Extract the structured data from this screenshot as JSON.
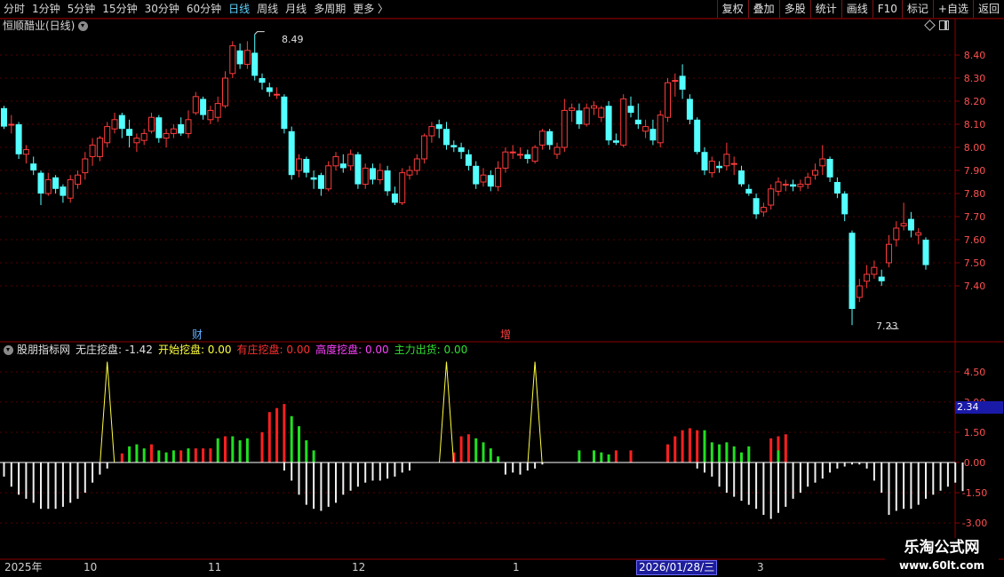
{
  "topbar": {
    "periods": [
      "分时",
      "1分钟",
      "5分钟",
      "15分钟",
      "30分钟",
      "60分钟",
      "日线",
      "周线",
      "月线",
      "多周期",
      "更多 〉"
    ],
    "active_period": "日线",
    "buttons": [
      "复权",
      "叠加",
      "多股",
      "统计",
      "画线",
      "F10",
      "标记",
      "+自选",
      "返回"
    ]
  },
  "stock": {
    "title": "恒顺醋业(日线)"
  },
  "price_axis": {
    "ticks": [
      "8.40",
      "8.30",
      "8.20",
      "8.10",
      "8.00",
      "7.90",
      "7.80",
      "7.70",
      "7.60",
      "7.50",
      "7.40"
    ]
  },
  "annotations": {
    "high": "8.49",
    "low": "7.23",
    "marker_cai": "财",
    "marker_zeng": "增"
  },
  "indicator": {
    "name": "股朋指标网",
    "items": [
      {
        "label": "无庄挖盘:",
        "value": "-1.42",
        "color": "#e0e0e0"
      },
      {
        "label": "开始挖盘:",
        "value": "0.00",
        "color": "#ffff40"
      },
      {
        "label": "有庄挖盘:",
        "value": "0.00",
        "color": "#ff3030"
      },
      {
        "label": "高度挖盘:",
        "value": "0.00",
        "color": "#ff40ff"
      },
      {
        "label": "主力出货:",
        "value": "0.00",
        "color": "#30e030"
      }
    ],
    "axis_ticks": [
      "4.50",
      "3.00",
      "1.50",
      "0.00",
      "-1.50",
      "-3.00"
    ],
    "current_value": "2.34"
  },
  "date_axis": {
    "labels": [
      "2025年",
      "10",
      "11",
      "12",
      "1",
      "3"
    ],
    "selected": "2026/01/28/三"
  },
  "watermark": {
    "line1": "乐淘公式网",
    "line2": "www.60lt.com"
  },
  "colors": {
    "up": "#ff3b3b",
    "down": "#54ffff",
    "grid": "#5a0000",
    "border": "#8b0000"
  },
  "chart_data": {
    "type": "candlestick",
    "title": "恒顺醋业(日线)",
    "ylim": [
      7.18,
      8.58
    ],
    "high_label": 8.49,
    "low_label": 7.23,
    "candles": [
      [
        8.17,
        8.09,
        8.18,
        8.08
      ],
      [
        8.1,
        8.1,
        8.14,
        8.06
      ],
      [
        8.1,
        7.97,
        8.11,
        7.95
      ],
      [
        7.97,
        7.99,
        8.01,
        7.93
      ],
      [
        7.93,
        7.9,
        7.96,
        7.88
      ],
      [
        7.89,
        7.8,
        7.9,
        7.75
      ],
      [
        7.8,
        7.86,
        7.89,
        7.79
      ],
      [
        7.87,
        7.82,
        7.88,
        7.8
      ],
      [
        7.83,
        7.79,
        7.84,
        7.76
      ],
      [
        7.78,
        7.86,
        7.88,
        7.76
      ],
      [
        7.84,
        7.88,
        7.9,
        7.82
      ],
      [
        7.89,
        7.95,
        7.98,
        7.86
      ],
      [
        7.96,
        8.01,
        8.04,
        7.92
      ],
      [
        7.96,
        8.04,
        8.05,
        7.94
      ],
      [
        8.02,
        8.09,
        8.11,
        8.0
      ],
      [
        8.08,
        8.12,
        8.15,
        8.06
      ],
      [
        8.14,
        8.08,
        8.15,
        8.04
      ],
      [
        8.08,
        8.05,
        8.12,
        8.0
      ],
      [
        8.02,
        8.04,
        8.06,
        7.98
      ],
      [
        8.03,
        8.06,
        8.08,
        8.01
      ],
      [
        8.07,
        8.13,
        8.15,
        8.06
      ],
      [
        8.13,
        8.04,
        8.14,
        8.02
      ],
      [
        8.04,
        8.06,
        8.08,
        8.0
      ],
      [
        8.06,
        8.08,
        8.1,
        8.04
      ],
      [
        8.1,
        8.06,
        8.13,
        8.05
      ],
      [
        8.06,
        8.12,
        8.16,
        8.04
      ],
      [
        8.15,
        8.22,
        8.24,
        8.14
      ],
      [
        8.21,
        8.14,
        8.22,
        8.12
      ],
      [
        8.12,
        8.16,
        8.18,
        8.1
      ],
      [
        8.13,
        8.19,
        8.22,
        8.11
      ],
      [
        8.18,
        8.3,
        8.33,
        8.17
      ],
      [
        8.32,
        8.44,
        8.46,
        8.3
      ],
      [
        8.42,
        8.36,
        8.45,
        8.34
      ],
      [
        8.36,
        8.42,
        8.46,
        8.34
      ],
      [
        8.41,
        8.31,
        8.49,
        8.29
      ],
      [
        8.3,
        8.28,
        8.32,
        8.25
      ],
      [
        8.26,
        8.24,
        8.28,
        8.22
      ],
      [
        8.23,
        8.23,
        8.26,
        8.21
      ],
      [
        8.22,
        8.08,
        8.23,
        8.06
      ],
      [
        8.07,
        7.88,
        8.09,
        7.86
      ],
      [
        7.9,
        7.95,
        7.97,
        7.87
      ],
      [
        7.95,
        7.89,
        7.96,
        7.87
      ],
      [
        7.87,
        7.86,
        7.9,
        7.82
      ],
      [
        7.88,
        7.82,
        7.89,
        7.79
      ],
      [
        7.82,
        7.92,
        7.94,
        7.81
      ],
      [
        7.92,
        7.96,
        7.98,
        7.9
      ],
      [
        7.93,
        7.91,
        7.97,
        7.89
      ],
      [
        7.92,
        7.97,
        7.99,
        7.9
      ],
      [
        7.97,
        7.84,
        7.98,
        7.82
      ],
      [
        7.84,
        7.91,
        7.93,
        7.82
      ],
      [
        7.91,
        7.86,
        7.93,
        7.84
      ],
      [
        7.86,
        7.9,
        7.93,
        7.84
      ],
      [
        7.9,
        7.81,
        7.92,
        7.79
      ],
      [
        7.8,
        7.76,
        7.83,
        7.75
      ],
      [
        7.76,
        7.89,
        7.91,
        7.75
      ],
      [
        7.88,
        7.9,
        7.92,
        7.86
      ],
      [
        7.9,
        7.95,
        7.97,
        7.88
      ],
      [
        7.95,
        8.05,
        8.06,
        7.93
      ],
      [
        8.05,
        8.09,
        8.11,
        8.02
      ],
      [
        8.1,
        8.08,
        8.12,
        8.04
      ],
      [
        8.08,
        8.01,
        8.11,
        7.99
      ],
      [
        8.01,
        8.0,
        8.03,
        7.98
      ],
      [
        8.0,
        7.98,
        8.02,
        7.95
      ],
      [
        7.97,
        7.92,
        7.99,
        7.9
      ],
      [
        7.92,
        7.84,
        7.94,
        7.82
      ],
      [
        7.85,
        7.88,
        7.91,
        7.83
      ],
      [
        7.88,
        7.83,
        7.9,
        7.81
      ],
      [
        7.83,
        7.91,
        7.94,
        7.81
      ],
      [
        7.91,
        7.98,
        8.0,
        7.89
      ],
      [
        7.98,
        7.98,
        8.01,
        7.95
      ],
      [
        7.97,
        7.97,
        8.0,
        7.95
      ],
      [
        7.97,
        7.95,
        7.99,
        7.93
      ],
      [
        7.94,
        8.0,
        8.01,
        7.93
      ],
      [
        8.01,
        8.07,
        8.08,
        7.99
      ],
      [
        8.07,
        8.01,
        8.08,
        7.99
      ],
      [
        7.97,
        8.0,
        8.02,
        7.95
      ],
      [
        8.0,
        8.16,
        8.21,
        7.98
      ],
      [
        8.16,
        8.17,
        8.19,
        8.11
      ],
      [
        8.16,
        8.1,
        8.19,
        8.08
      ],
      [
        8.1,
        8.17,
        8.19,
        8.09
      ],
      [
        8.17,
        8.18,
        8.2,
        8.14
      ],
      [
        8.13,
        8.17,
        8.18,
        8.11
      ],
      [
        8.18,
        8.03,
        8.2,
        8.01
      ],
      [
        8.03,
        8.02,
        8.06,
        8.01
      ],
      [
        8.01,
        8.21,
        8.23,
        8.0
      ],
      [
        8.18,
        8.15,
        8.22,
        8.13
      ],
      [
        8.12,
        8.1,
        8.19,
        8.08
      ],
      [
        8.07,
        8.09,
        8.12,
        8.04
      ],
      [
        8.08,
        8.03,
        8.12,
        8.01
      ],
      [
        8.02,
        8.14,
        8.16,
        8.0
      ],
      [
        8.13,
        8.28,
        8.3,
        8.11
      ],
      [
        8.29,
        8.29,
        8.32,
        8.22
      ],
      [
        8.31,
        8.25,
        8.36,
        8.21
      ],
      [
        8.21,
        8.12,
        8.23,
        8.1
      ],
      [
        8.12,
        7.98,
        8.13,
        7.97
      ],
      [
        7.98,
        7.9,
        8.0,
        7.88
      ],
      [
        7.89,
        7.94,
        7.96,
        7.87
      ],
      [
        7.92,
        7.91,
        7.94,
        7.89
      ],
      [
        7.92,
        7.97,
        8.02,
        7.9
      ],
      [
        7.93,
        7.93,
        7.96,
        7.88
      ],
      [
        7.9,
        7.84,
        7.92,
        7.83
      ],
      [
        7.82,
        7.8,
        7.84,
        7.79
      ],
      [
        7.78,
        7.71,
        7.8,
        7.69
      ],
      [
        7.72,
        7.74,
        7.76,
        7.7
      ],
      [
        7.75,
        7.82,
        7.84,
        7.73
      ],
      [
        7.81,
        7.85,
        7.87,
        7.79
      ],
      [
        7.84,
        7.84,
        7.86,
        7.81
      ],
      [
        7.84,
        7.83,
        7.86,
        7.81
      ],
      [
        7.83,
        7.84,
        7.86,
        7.81
      ],
      [
        7.84,
        7.87,
        7.89,
        7.82
      ],
      [
        7.88,
        7.9,
        7.93,
        7.86
      ],
      [
        7.92,
        7.95,
        8.01,
        7.88
      ],
      [
        7.95,
        7.87,
        7.96,
        7.85
      ],
      [
        7.85,
        7.8,
        7.87,
        7.78
      ],
      [
        7.8,
        7.71,
        7.81,
        7.68
      ],
      [
        7.63,
        7.3,
        7.64,
        7.23
      ],
      [
        7.35,
        7.4,
        7.43,
        7.33
      ],
      [
        7.42,
        7.45,
        7.49,
        7.39
      ],
      [
        7.45,
        7.48,
        7.51,
        7.43
      ],
      [
        7.44,
        7.42,
        7.47,
        7.4
      ],
      [
        7.5,
        7.58,
        7.62,
        7.48
      ],
      [
        7.6,
        7.65,
        7.68,
        7.57
      ],
      [
        7.66,
        7.67,
        7.76,
        7.64
      ],
      [
        7.69,
        7.64,
        7.72,
        7.61
      ],
      [
        7.62,
        7.63,
        7.65,
        7.58
      ],
      [
        7.6,
        7.49,
        7.61,
        7.47
      ]
    ],
    "indicator_series": {
      "white": [
        -0.7,
        -1.2,
        -1.6,
        -1.8,
        -2.0,
        -2.3,
        -2.3,
        -2.3,
        -2.2,
        -2.0,
        -1.8,
        -1.5,
        -1.0,
        -0.6,
        -0.3,
        0,
        0,
        0,
        0,
        0,
        0,
        0,
        0,
        0,
        0,
        0,
        0,
        0,
        0,
        0,
        0,
        0,
        0,
        0,
        0,
        0,
        0,
        0,
        -0.4,
        -0.9,
        -1.6,
        -2.1,
        -2.3,
        -2.4,
        -2.2,
        -2.0,
        -1.6,
        -1.4,
        -1.2,
        -1.0,
        -0.9,
        -0.9,
        -0.8,
        -0.7,
        -0.5,
        -0.4,
        0,
        0,
        0,
        0,
        0,
        0,
        0,
        0,
        0,
        0,
        0,
        0,
        -0.6,
        -0.5,
        -0.6,
        -0.4,
        -0.3,
        -0.1,
        0,
        0,
        0,
        0,
        0,
        0,
        0,
        0,
        0,
        0,
        0,
        0,
        0,
        0,
        0,
        0,
        0,
        0,
        0,
        0,
        -0.3,
        -0.5,
        -0.7,
        -1.2,
        -1.5,
        -1.7,
        -1.9,
        -2.1,
        -2.3,
        -2.6,
        -2.8,
        -2.5,
        -2.2,
        -1.8,
        -1.5,
        -1.2,
        -1.0,
        -0.8,
        -0.5,
        -0.3,
        -0.2,
        -0.1,
        -0.1,
        -0.3,
        -0.9,
        -1.5,
        -2.6,
        -2.4,
        -2.3,
        -2.3,
        -2.1,
        -1.8,
        -1.6,
        -1.4,
        -1.2,
        -1.0,
        -1.42
      ],
      "red": [
        0,
        0,
        0,
        0,
        0,
        0,
        0,
        0,
        0,
        0,
        0,
        0,
        0,
        0,
        0,
        0,
        0.45,
        0,
        0,
        0,
        0.9,
        0,
        0,
        0,
        0.6,
        0,
        0.7,
        0.7,
        0.7,
        0,
        1.3,
        0,
        0,
        0,
        0,
        1.5,
        2.5,
        2.7,
        2.9,
        0,
        0,
        0,
        0,
        0,
        0,
        0,
        0,
        0,
        0,
        0,
        0,
        0,
        0,
        0,
        0,
        0,
        0,
        0,
        0,
        0,
        0,
        0.5,
        1.3,
        1.4,
        0,
        0,
        0,
        0,
        0,
        0,
        0,
        0,
        0,
        0,
        0,
        0,
        0,
        0,
        0,
        0,
        0,
        0,
        0,
        0.6,
        0,
        0.6,
        0,
        0,
        0,
        0,
        0.9,
        1.3,
        1.6,
        1.7,
        1.6,
        0,
        0,
        0,
        0,
        0,
        0,
        0,
        0,
        0,
        1.2,
        1.3,
        1.4,
        0,
        0,
        0,
        0,
        0,
        0,
        0,
        0,
        0,
        0,
        0,
        0,
        0,
        0,
        0,
        0,
        0,
        0,
        0,
        0,
        0,
        0,
        0,
        0,
        0,
        0,
        0,
        0,
        0
      ],
      "green": [
        0,
        0,
        0,
        0,
        0,
        0,
        0,
        0,
        0,
        0,
        0,
        0,
        0,
        0,
        0,
        0,
        0,
        0.8,
        0.9,
        0.7,
        0,
        0.6,
        0.5,
        0.6,
        0,
        0.7,
        0,
        0,
        0,
        1.2,
        0,
        1.3,
        1.1,
        1.2,
        0,
        0,
        0,
        0,
        0,
        2.3,
        1.8,
        1.1,
        0.6,
        0,
        0,
        0,
        0,
        0,
        0,
        0,
        0,
        0,
        0,
        0,
        0,
        0,
        0,
        0,
        0,
        0,
        0,
        0,
        0,
        0,
        1.2,
        1.0,
        0.7,
        0.3,
        0,
        0,
        0,
        0,
        0,
        0,
        0,
        0,
        0,
        0,
        0.6,
        0,
        0.6,
        0.5,
        0.4,
        0,
        0,
        0,
        0,
        0,
        0,
        0,
        0,
        0,
        0,
        0,
        0,
        1.6,
        1.0,
        0.9,
        1.0,
        0.8,
        0.5,
        0.8,
        0,
        0,
        0,
        0.6,
        0,
        0,
        0,
        0,
        0,
        0,
        0,
        0,
        0,
        0,
        0,
        0,
        0,
        0,
        0,
        0,
        0,
        0,
        0,
        0,
        0,
        0,
        0,
        0,
        0,
        0,
        0,
        0
      ]
    }
  }
}
